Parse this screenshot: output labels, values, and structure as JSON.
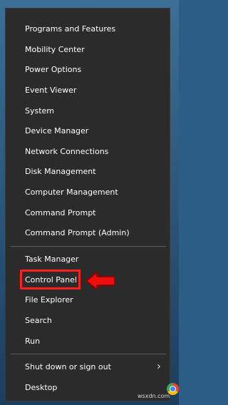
{
  "menu": {
    "items": [
      {
        "label": "Programs and Features"
      },
      {
        "label": "Mobility Center"
      },
      {
        "label": "Power Options"
      },
      {
        "label": "Event Viewer"
      },
      {
        "label": "System"
      },
      {
        "label": "Device Manager"
      },
      {
        "label": "Network Connections"
      },
      {
        "label": "Disk Management"
      },
      {
        "label": "Computer Management"
      },
      {
        "label": "Command Prompt"
      },
      {
        "label": "Command Prompt (Admin)"
      },
      {
        "label": "Task Manager"
      },
      {
        "label": "Control Panel"
      },
      {
        "label": "File Explorer"
      },
      {
        "label": "Search"
      },
      {
        "label": "Run"
      },
      {
        "label": "Shut down or sign out"
      },
      {
        "label": "Desktop"
      }
    ],
    "submenu_arrow": "›"
  },
  "annotation": {
    "highlight_color": "#ff1f1f",
    "arrow_icon": "red-left-arrow"
  },
  "watermark": {
    "text": "wsxdn.com"
  },
  "icons": {
    "browser": "chrome-icon"
  }
}
